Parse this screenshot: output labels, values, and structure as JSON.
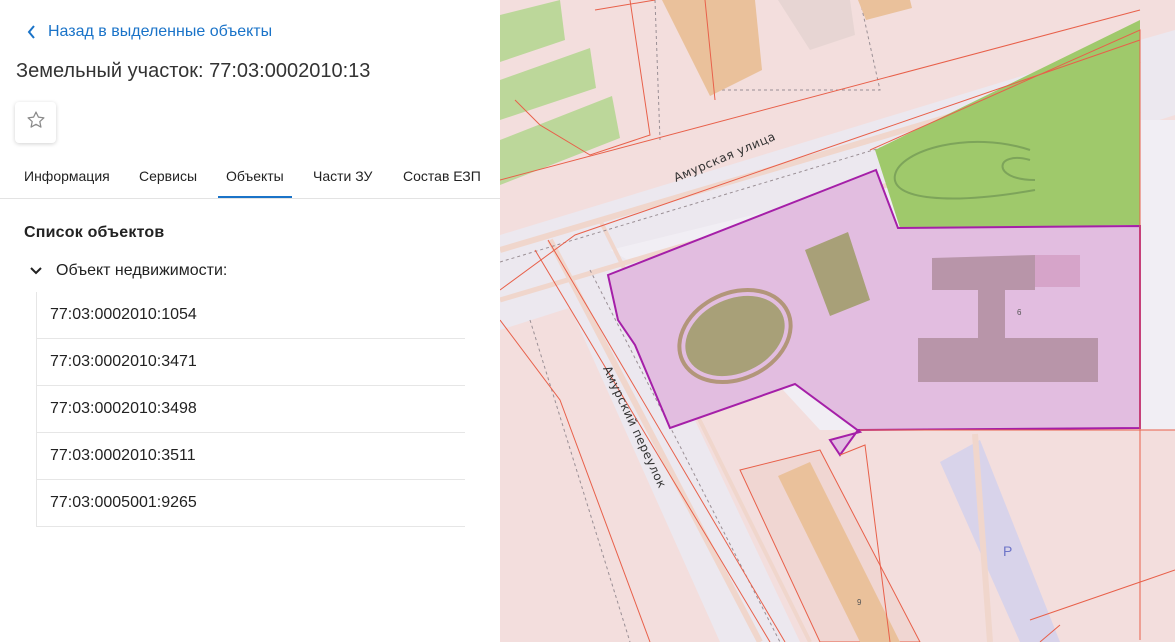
{
  "panel": {
    "back_label": "Назад в выделенные объекты",
    "title": "Земельный участок: 77:03:0002010:13",
    "tabs": [
      {
        "label": "Информация"
      },
      {
        "label": "Сервисы"
      },
      {
        "label": "Объекты",
        "active": true
      },
      {
        "label": "Части ЗУ"
      },
      {
        "label": "Состав ЕЗП"
      }
    ],
    "section_title": "Список объектов",
    "group_label": "Объект недвижимости:",
    "objects": [
      "77:03:0002010:1054",
      "77:03:0002010:3471",
      "77:03:0002010:3498",
      "77:03:0002010:3511",
      "77:03:0005001:9265"
    ]
  },
  "map": {
    "street_1": "Амурская улица",
    "street_2": "Амурский переулок",
    "building_num_1": "6",
    "building_num_2": "9",
    "parking_label": "P",
    "colors": {
      "parcel_fill": "#e2bde0",
      "parcel_border": "#a51fa8",
      "green": "#9fc96b",
      "building": "#b08e9f",
      "orange": "#eac19b",
      "boundary": "#e8604a"
    }
  }
}
